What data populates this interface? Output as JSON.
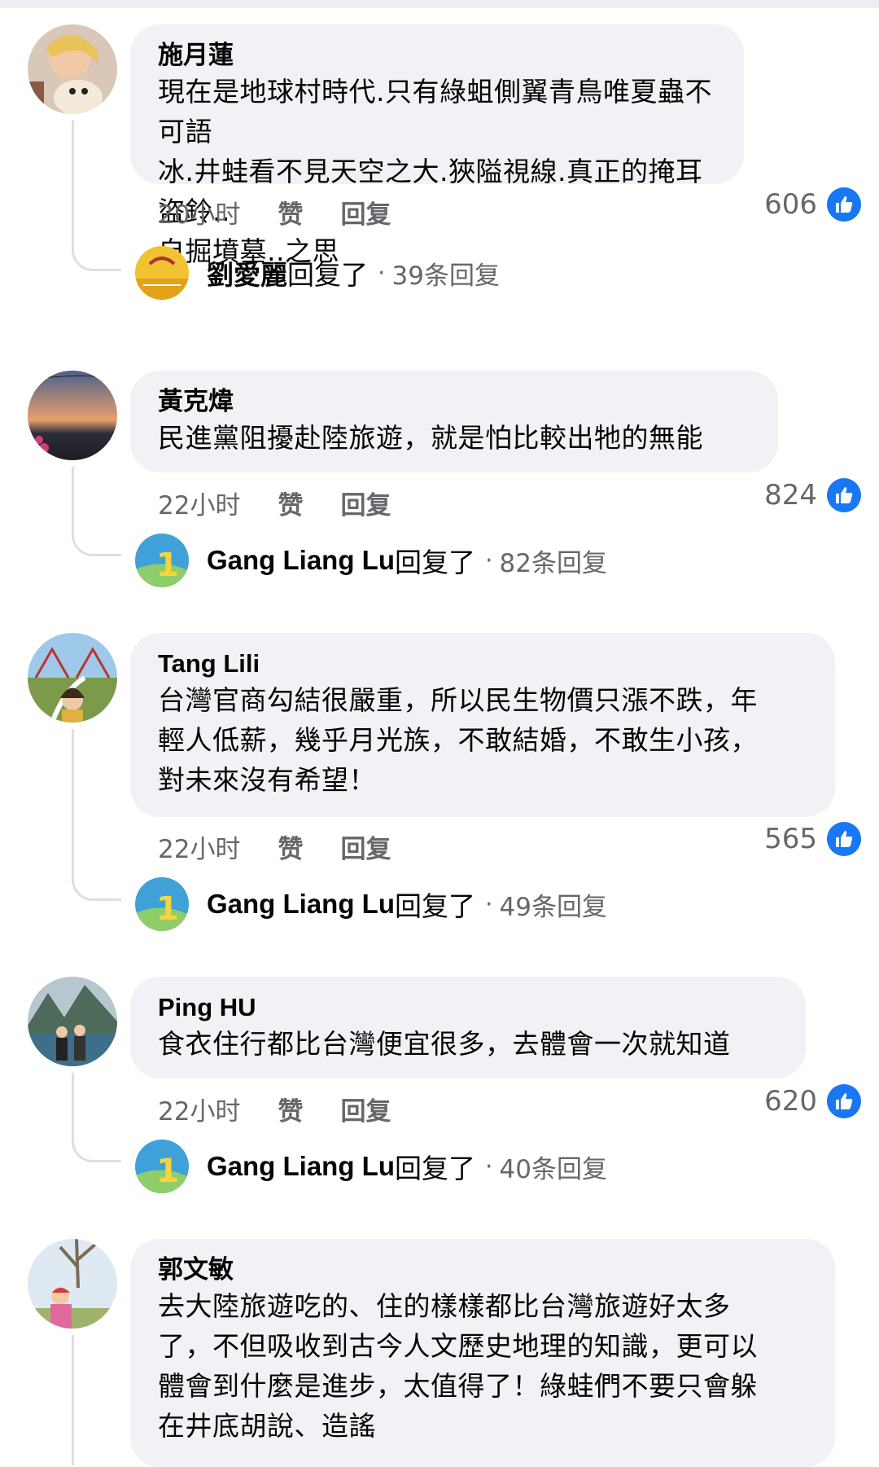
{
  "colors": {
    "bubble": "#f0f2f5",
    "meta": "#65676b",
    "like_blue": "#1877f2"
  },
  "comments": [
    {
      "author": "施月蓮",
      "lines": [
        "現在是地球村時代.只有綠蛆側翼青鳥唯夏蟲不可語",
        "冰.井蛙看不見天空之大.狹隘視線.真正的掩耳盜鈴..",
        "自掘墳墓..之思"
      ],
      "time": "20小时",
      "like_label": "赞",
      "reply_label": "回复",
      "likes": "606",
      "reply": {
        "name": "劉愛麗",
        "verb": "回复了",
        "count": "39条回复"
      },
      "avatar_icon": "woman-with-dog-avatar"
    },
    {
      "author": "黃克煒",
      "lines": [
        "民進黨阻擾赴陸旅遊，就是怕比較出牠的無能"
      ],
      "time": "22小时",
      "like_label": "赞",
      "reply_label": "回复",
      "likes": "824",
      "reply": {
        "name": "Gang Liang Lu",
        "verb": "回复了",
        "count": "82条回复"
      },
      "avatar_icon": "sunset-avatar"
    },
    {
      "author": "Tang Lili",
      "lines": [
        "台灣官商勾結很嚴重，所以民生物價只漲不跌，年",
        "輕人低薪，幾乎月光族，不敢結婚，不敢生小孩，",
        "對未來沒有希望！"
      ],
      "time": "22小时",
      "like_label": "赞",
      "reply_label": "回复",
      "likes": "565",
      "reply": {
        "name": "Gang Liang Lu",
        "verb": "回复了",
        "count": "49条回复"
      },
      "avatar_icon": "bridge-selfie-avatar"
    },
    {
      "author": "Ping HU",
      "lines": [
        "食衣住行都比台灣便宜很多，去體會一次就知道"
      ],
      "time": "22小时",
      "like_label": "赞",
      "reply_label": "回复",
      "likes": "620",
      "reply": {
        "name": "Gang Liang Lu",
        "verb": "回复了",
        "count": "40条回复"
      },
      "avatar_icon": "couple-landscape-avatar"
    },
    {
      "author": "郭文敏",
      "lines": [
        "去大陸旅遊吃的、住的樣樣都比台灣旅遊好太多",
        "了，不但吸收到古今人文歷史地理的知識，更可以",
        "體會到什麼是進步，太值得了！綠蛙們不要只會躲",
        "在井底胡說、造謠"
      ],
      "avatar_icon": "tree-portrait-avatar"
    }
  ]
}
